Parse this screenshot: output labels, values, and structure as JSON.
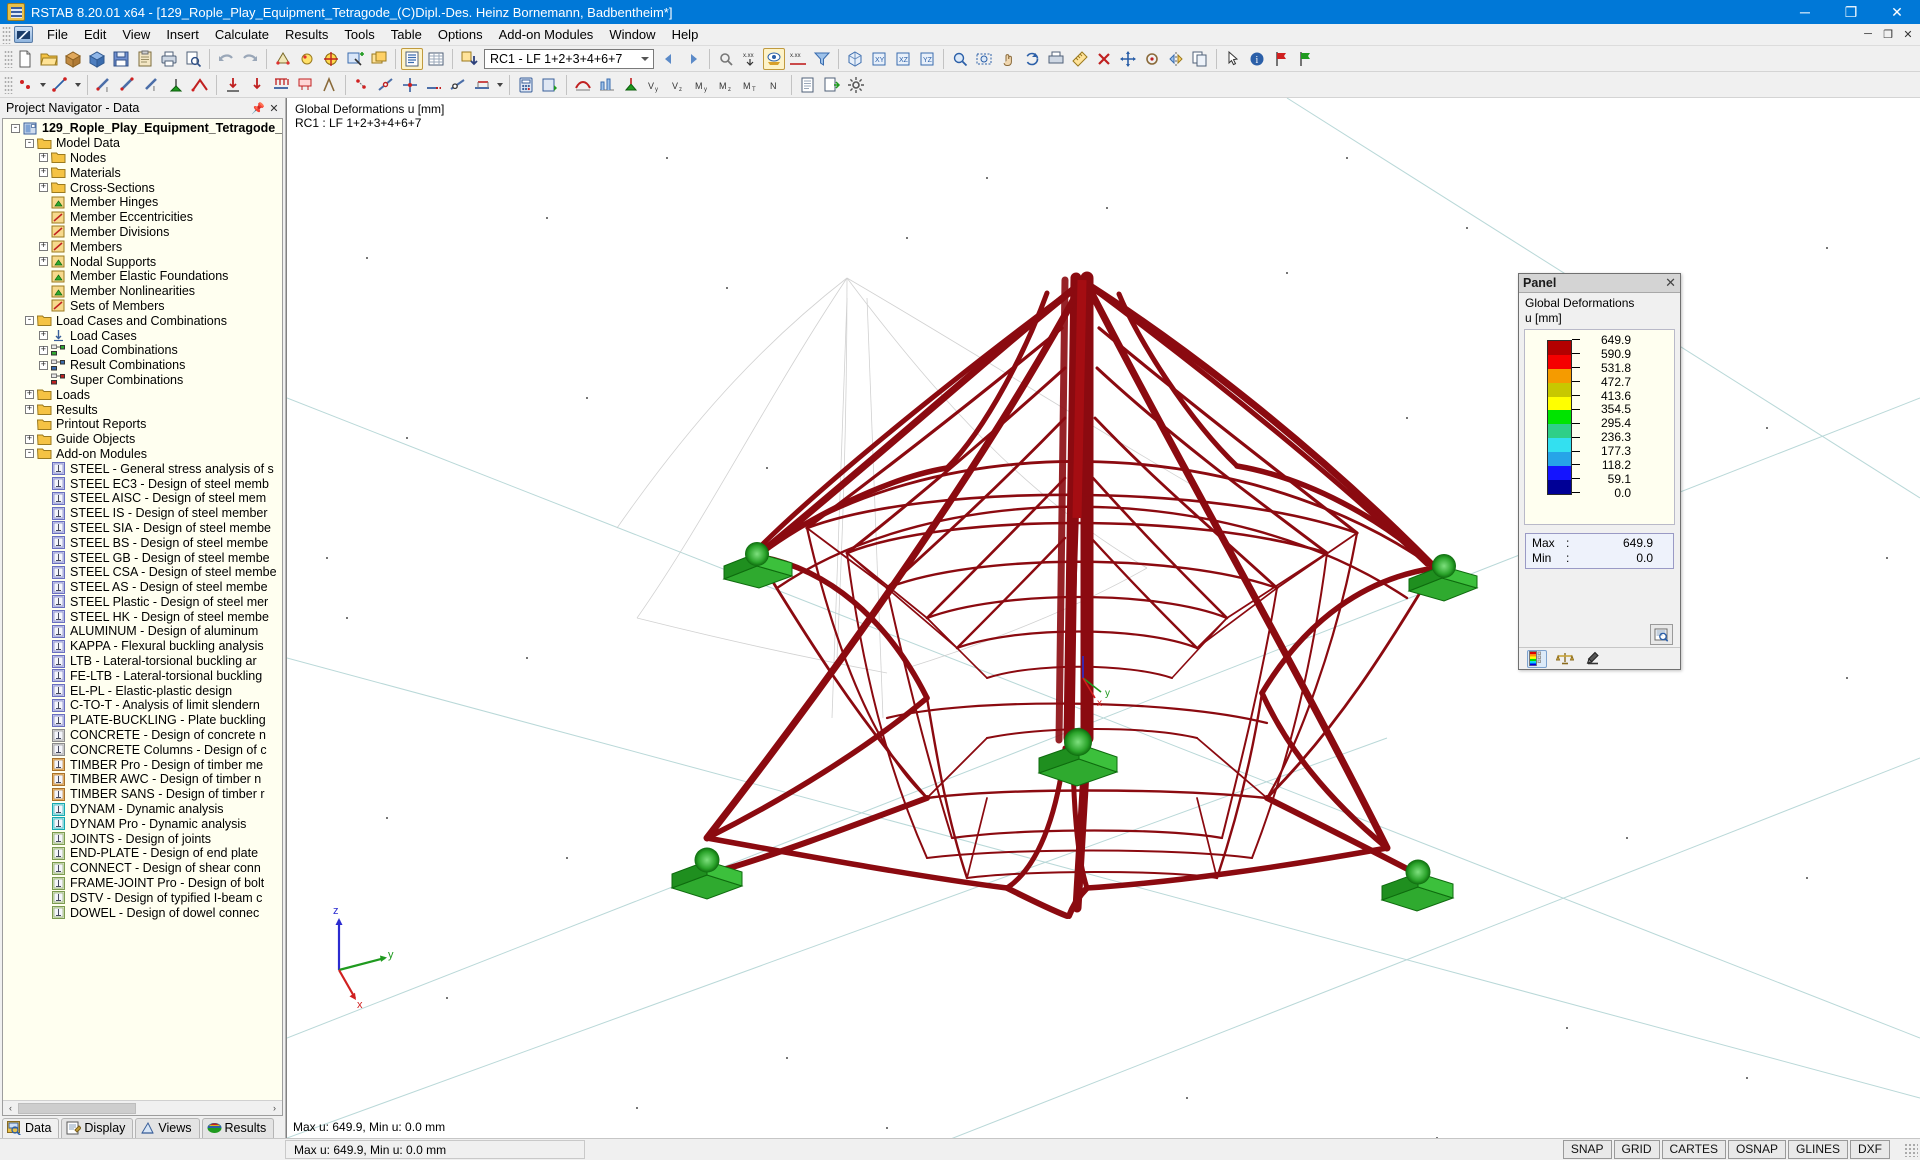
{
  "window": {
    "title": "RSTAB 8.20.01 x64 - [129_Rople_Play_Equipment_Tetragode_(C)Dipl.-Des. Heinz Bornemann, Badbentheim*]",
    "minimize": "─",
    "maximize": "❐",
    "close": "✕"
  },
  "menubar": {
    "items": [
      "File",
      "Edit",
      "View",
      "Insert",
      "Calculate",
      "Results",
      "Tools",
      "Table",
      "Options",
      "Add-on Modules",
      "Window",
      "Help"
    ],
    "mdi": [
      "─",
      "❐",
      "✕"
    ]
  },
  "toolbar": {
    "load_case_value": "RC1 - LF 1+2+3+4+6+7",
    "icons_row1": [
      "new-file-icon",
      "open-folder-icon",
      "open-package-icon",
      "save-as-icon",
      "save-icon",
      "clipboard-icon",
      "print-icon",
      "print-preview-icon",
      "undo-icon",
      "redo-icon",
      "render-model-icon",
      "lighting-icon",
      "target-icon",
      "select-special-icon",
      "new-window-icon",
      "show-tables-icon",
      "table-grid-icon",
      "load-case-add-icon"
    ],
    "icons_row2": [
      "node-icon",
      "line-icon",
      "member-icon",
      "member-set-icon",
      "support-icon",
      "hinge-icon",
      "load-icon",
      "nodal-load-icon",
      "member-load-icon",
      "calculate-icon",
      "results-icon",
      "deformation-icon"
    ]
  },
  "navigator": {
    "title": "Project Navigator - Data",
    "pin_icon": "pin-icon",
    "close_icon": "close-icon",
    "scroll_left": "‹",
    "scroll_right": "›",
    "tree": [
      {
        "depth": 0,
        "exp": "-",
        "icon": "project-icon",
        "label": "129_Rople_Play_Equipment_Tetragode_",
        "root": true
      },
      {
        "depth": 1,
        "exp": "-",
        "icon": "folder-icon",
        "label": "Model Data"
      },
      {
        "depth": 2,
        "exp": "+",
        "icon": "folder-node-icon",
        "label": "Nodes"
      },
      {
        "depth": 2,
        "exp": "+",
        "icon": "folder-material-icon",
        "label": "Materials"
      },
      {
        "depth": 2,
        "exp": "+",
        "icon": "folder-section-icon",
        "label": "Cross-Sections"
      },
      {
        "depth": 2,
        "exp": "",
        "icon": "folder-hinge-icon",
        "label": "Member Hinges"
      },
      {
        "depth": 2,
        "exp": "",
        "icon": "eccentricity-icon",
        "label": "Member Eccentricities"
      },
      {
        "depth": 2,
        "exp": "",
        "icon": "division-icon",
        "label": "Member Divisions"
      },
      {
        "depth": 2,
        "exp": "+",
        "icon": "member-icon",
        "label": "Members"
      },
      {
        "depth": 2,
        "exp": "+",
        "icon": "support-folder-icon",
        "label": "Nodal Supports"
      },
      {
        "depth": 2,
        "exp": "",
        "icon": "foundation-icon",
        "label": "Member Elastic Foundations"
      },
      {
        "depth": 2,
        "exp": "",
        "icon": "nonlinearity-icon",
        "label": "Member Nonlinearities"
      },
      {
        "depth": 2,
        "exp": "",
        "icon": "member-set-icon",
        "label": "Sets of Members"
      },
      {
        "depth": 1,
        "exp": "-",
        "icon": "folder-icon",
        "label": "Load Cases and Combinations"
      },
      {
        "depth": 2,
        "exp": "+",
        "icon": "load-case-icon",
        "label": "Load Cases"
      },
      {
        "depth": 2,
        "exp": "+",
        "icon": "combination-icon",
        "label": "Load Combinations"
      },
      {
        "depth": 2,
        "exp": "+",
        "icon": "result-comb-icon",
        "label": "Result Combinations"
      },
      {
        "depth": 2,
        "exp": "",
        "icon": "super-comb-icon",
        "label": "Super Combinations"
      },
      {
        "depth": 1,
        "exp": "+",
        "icon": "folder-icon",
        "label": "Loads"
      },
      {
        "depth": 1,
        "exp": "+",
        "icon": "folder-icon",
        "label": "Results"
      },
      {
        "depth": 1,
        "exp": "",
        "icon": "folder-icon",
        "label": "Printout Reports"
      },
      {
        "depth": 1,
        "exp": "+",
        "icon": "folder-icon",
        "label": "Guide Objects"
      },
      {
        "depth": 1,
        "exp": "-",
        "icon": "folder-icon",
        "label": "Add-on Modules"
      },
      {
        "depth": 2,
        "exp": "",
        "icon": "module-steel-icon",
        "label": "STEEL - General stress analysis of s"
      },
      {
        "depth": 2,
        "exp": "",
        "icon": "module-ec3-icon",
        "label": "STEEL EC3 - Design of steel memb"
      },
      {
        "depth": 2,
        "exp": "",
        "icon": "module-aisc-icon",
        "label": "STEEL AISC - Design of steel mem"
      },
      {
        "depth": 2,
        "exp": "",
        "icon": "module-is-icon",
        "label": "STEEL IS - Design of steel member"
      },
      {
        "depth": 2,
        "exp": "",
        "icon": "module-sia-icon",
        "label": "STEEL SIA - Design of steel membe"
      },
      {
        "depth": 2,
        "exp": "",
        "icon": "module-bs-icon",
        "label": "STEEL BS - Design of steel membe"
      },
      {
        "depth": 2,
        "exp": "",
        "icon": "module-gb-icon",
        "label": "STEEL GB - Design of steel membe"
      },
      {
        "depth": 2,
        "exp": "",
        "icon": "module-csa-icon",
        "label": "STEEL CSA - Design of steel membe"
      },
      {
        "depth": 2,
        "exp": "",
        "icon": "module-as-icon",
        "label": "STEEL AS - Design of steel membe"
      },
      {
        "depth": 2,
        "exp": "",
        "icon": "module-plastic-icon",
        "label": "STEEL Plastic - Design of steel mer"
      },
      {
        "depth": 2,
        "exp": "",
        "icon": "module-hk-icon",
        "label": "STEEL HK - Design of steel membe"
      },
      {
        "depth": 2,
        "exp": "",
        "icon": "module-alu-icon",
        "label": "ALUMINUM - Design of aluminum"
      },
      {
        "depth": 2,
        "exp": "",
        "icon": "module-kappa-icon",
        "label": "KAPPA - Flexural buckling analysis"
      },
      {
        "depth": 2,
        "exp": "",
        "icon": "module-ltb-icon",
        "label": "LTB - Lateral-torsional buckling ar"
      },
      {
        "depth": 2,
        "exp": "",
        "icon": "module-feltb-icon",
        "label": "FE-LTB - Lateral-torsional buckling"
      },
      {
        "depth": 2,
        "exp": "",
        "icon": "module-elpl-icon",
        "label": "EL-PL - Elastic-plastic design"
      },
      {
        "depth": 2,
        "exp": "",
        "icon": "module-ctot-icon",
        "label": "C-TO-T - Analysis of limit slendern"
      },
      {
        "depth": 2,
        "exp": "",
        "icon": "module-plate-icon",
        "label": "PLATE-BUCKLING - Plate buckling"
      },
      {
        "depth": 2,
        "exp": "",
        "icon": "module-concrete-icon",
        "label": "CONCRETE - Design of concrete n"
      },
      {
        "depth": 2,
        "exp": "",
        "icon": "module-column-icon",
        "label": "CONCRETE Columns - Design of c"
      },
      {
        "depth": 2,
        "exp": "",
        "icon": "module-timber-icon",
        "label": "TIMBER Pro - Design of timber me"
      },
      {
        "depth": 2,
        "exp": "",
        "icon": "module-awc-icon",
        "label": "TIMBER AWC - Design of timber n"
      },
      {
        "depth": 2,
        "exp": "",
        "icon": "module-sans-icon",
        "label": "TIMBER SANS - Design of timber r"
      },
      {
        "depth": 2,
        "exp": "",
        "icon": "module-dynam-icon",
        "label": "DYNAM - Dynamic analysis"
      },
      {
        "depth": 2,
        "exp": "",
        "icon": "module-dynampro-icon",
        "label": "DYNAM Pro - Dynamic analysis"
      },
      {
        "depth": 2,
        "exp": "",
        "icon": "module-joints-icon",
        "label": "JOINTS - Design of joints"
      },
      {
        "depth": 2,
        "exp": "",
        "icon": "module-endplate-icon",
        "label": "END-PLATE - Design of end plate"
      },
      {
        "depth": 2,
        "exp": "",
        "icon": "module-connect-icon",
        "label": "CONNECT - Design of shear conn"
      },
      {
        "depth": 2,
        "exp": "",
        "icon": "module-frame-icon",
        "label": "FRAME-JOINT Pro - Design of bolt"
      },
      {
        "depth": 2,
        "exp": "",
        "icon": "module-dstv-icon",
        "label": "DSTV - Design of typified I-beam c"
      },
      {
        "depth": 2,
        "exp": "",
        "icon": "module-dowel-icon",
        "label": "DOWEL - Design of dowel connec"
      }
    ],
    "tabs": [
      {
        "label": "Data",
        "icon": "data-icon",
        "active": true
      },
      {
        "label": "Display",
        "icon": "display-icon",
        "active": false
      },
      {
        "label": "Views",
        "icon": "views-icon",
        "active": false
      },
      {
        "label": "Results",
        "icon": "results-icon",
        "active": false
      }
    ]
  },
  "viewport": {
    "label_line1": "Global Deformations u [mm]",
    "label_line2": "RC1 : LF 1+2+3+4+6+7",
    "status_text": "Max u: 649.9, Min u: 0.0 mm",
    "axes": {
      "x": "x",
      "y": "y",
      "z": "z"
    },
    "background": "#ffffff",
    "member_color": "#8b0a10",
    "support_color": "#1f9a1f",
    "grid_color": "#bcd8d8"
  },
  "panel": {
    "title": "Panel",
    "close_icon": "close-icon",
    "subtitle_line1": "Global Deformations",
    "subtitle_line2": "u [mm]",
    "max_label": "Max",
    "min_label": "Min",
    "colon": ":",
    "max_value": "649.9",
    "min_value": "0.0",
    "zoom_icon": "zoom-fit-icon",
    "tabs": [
      {
        "name": "color-scale-tab",
        "active": true
      },
      {
        "name": "factors-tab",
        "active": false
      },
      {
        "name": "filter-tab",
        "active": false
      }
    ]
  },
  "chart_data": {
    "type": "heatmap",
    "title": "Global Deformations",
    "ylabel": "u [mm]",
    "unit": "mm",
    "legend_position": "right-panel",
    "scale_labels": [
      "649.9",
      "590.9",
      "531.8",
      "472.7",
      "413.6",
      "354.5",
      "295.4",
      "236.3",
      "177.3",
      "118.2",
      "59.1",
      "0.0"
    ],
    "scale_values": [
      649.9,
      590.9,
      531.8,
      472.7,
      413.6,
      354.5,
      295.4,
      236.3,
      177.3,
      118.2,
      59.1,
      0.0
    ],
    "scale_colors": [
      "#b30000",
      "#f50000",
      "#f59b00",
      "#c8c800",
      "#ffff00",
      "#00e400",
      "#2fcf87",
      "#33e0f0",
      "#26a4e8",
      "#1414ff",
      "#000096"
    ],
    "max": 649.9,
    "min": 0.0,
    "load_case": "RC1 : LF 1+2+3+4+6+7"
  },
  "statusbar": {
    "left_text": "Max u: 649.9, Min u: 0.0 mm",
    "cells": [
      "SNAP",
      "GRID",
      "CARTES",
      "OSNAP",
      "GLINES",
      "DXF"
    ]
  }
}
